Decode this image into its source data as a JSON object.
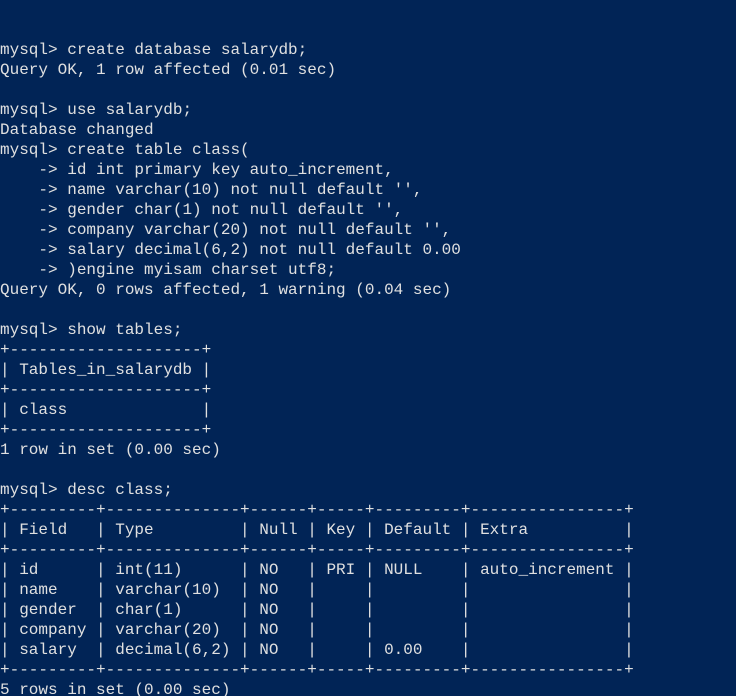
{
  "lines": {
    "0": {
      "prompt": "mysql>",
      "cmd": "create database salarydb;"
    },
    "1": "Query OK, 1 row affected (0.01 sec)",
    "2": {
      "prompt": "mysql>",
      "cmd": "use salarydb;"
    },
    "3": "Database changed",
    "4": {
      "prompt": "mysql>",
      "cmd": "create table class("
    },
    "5": {
      "prompt": "    ->",
      "cmd": "id int primary key auto_increment,"
    },
    "6": {
      "prompt": "    ->",
      "cmd": "name varchar(10) not null default '',"
    },
    "7": {
      "prompt": "    ->",
      "cmd": "gender char(1) not null default '',"
    },
    "8": {
      "prompt": "    ->",
      "cmd": "company varchar(20) not null default '',"
    },
    "9": {
      "prompt": "    ->",
      "cmd": "salary decimal(6,2) not null default 0.00"
    },
    "10": {
      "prompt": "    ->",
      "cmd": ")engine myisam charset utf8;"
    },
    "11": "Query OK, 0 rows affected, 1 warning (0.04 sec)",
    "12": {
      "prompt": "mysql>",
      "cmd": "show tables;"
    },
    "13": "+--------------------+",
    "14": "| Tables_in_salarydb |",
    "15": "+--------------------+",
    "16": "| class              |",
    "17": "+--------------------+",
    "18": "1 row in set (0.00 sec)",
    "19": {
      "prompt": "mysql>",
      "cmd": "desc class;"
    },
    "20": "+---------+--------------+------+-----+---------+----------------+",
    "21": "| Field   | Type         | Null | Key | Default | Extra          |",
    "22": "+---------+--------------+------+-----+---------+----------------+",
    "23": "| id      | int(11)      | NO   | PRI | NULL    | auto_increment |",
    "24": "| name    | varchar(10)  | NO   |     |         |                |",
    "25": "| gender  | char(1)      | NO   |     |         |                |",
    "26": "| company | varchar(20)  | NO   |     |         |                |",
    "27": "| salary  | decimal(6,2) | NO   |     | 0.00    |                |",
    "28": "+---------+--------------+------+-----+---------+----------------+",
    "29": "5 rows in set (0.00 sec)"
  },
  "tables": {
    "show_tables": {
      "header": "Tables_in_salarydb",
      "rows": [
        "class"
      ]
    },
    "desc_class": {
      "columns": [
        "Field",
        "Type",
        "Null",
        "Key",
        "Default",
        "Extra"
      ],
      "rows": [
        {
          "Field": "id",
          "Type": "int(11)",
          "Null": "NO",
          "Key": "PRI",
          "Default": "NULL",
          "Extra": "auto_increment"
        },
        {
          "Field": "name",
          "Type": "varchar(10)",
          "Null": "NO",
          "Key": "",
          "Default": "",
          "Extra": ""
        },
        {
          "Field": "gender",
          "Type": "char(1)",
          "Null": "NO",
          "Key": "",
          "Default": "",
          "Extra": ""
        },
        {
          "Field": "company",
          "Type": "varchar(20)",
          "Null": "NO",
          "Key": "",
          "Default": "",
          "Extra": ""
        },
        {
          "Field": "salary",
          "Type": "decimal(6,2)",
          "Null": "NO",
          "Key": "",
          "Default": "0.00",
          "Extra": ""
        }
      ]
    }
  }
}
